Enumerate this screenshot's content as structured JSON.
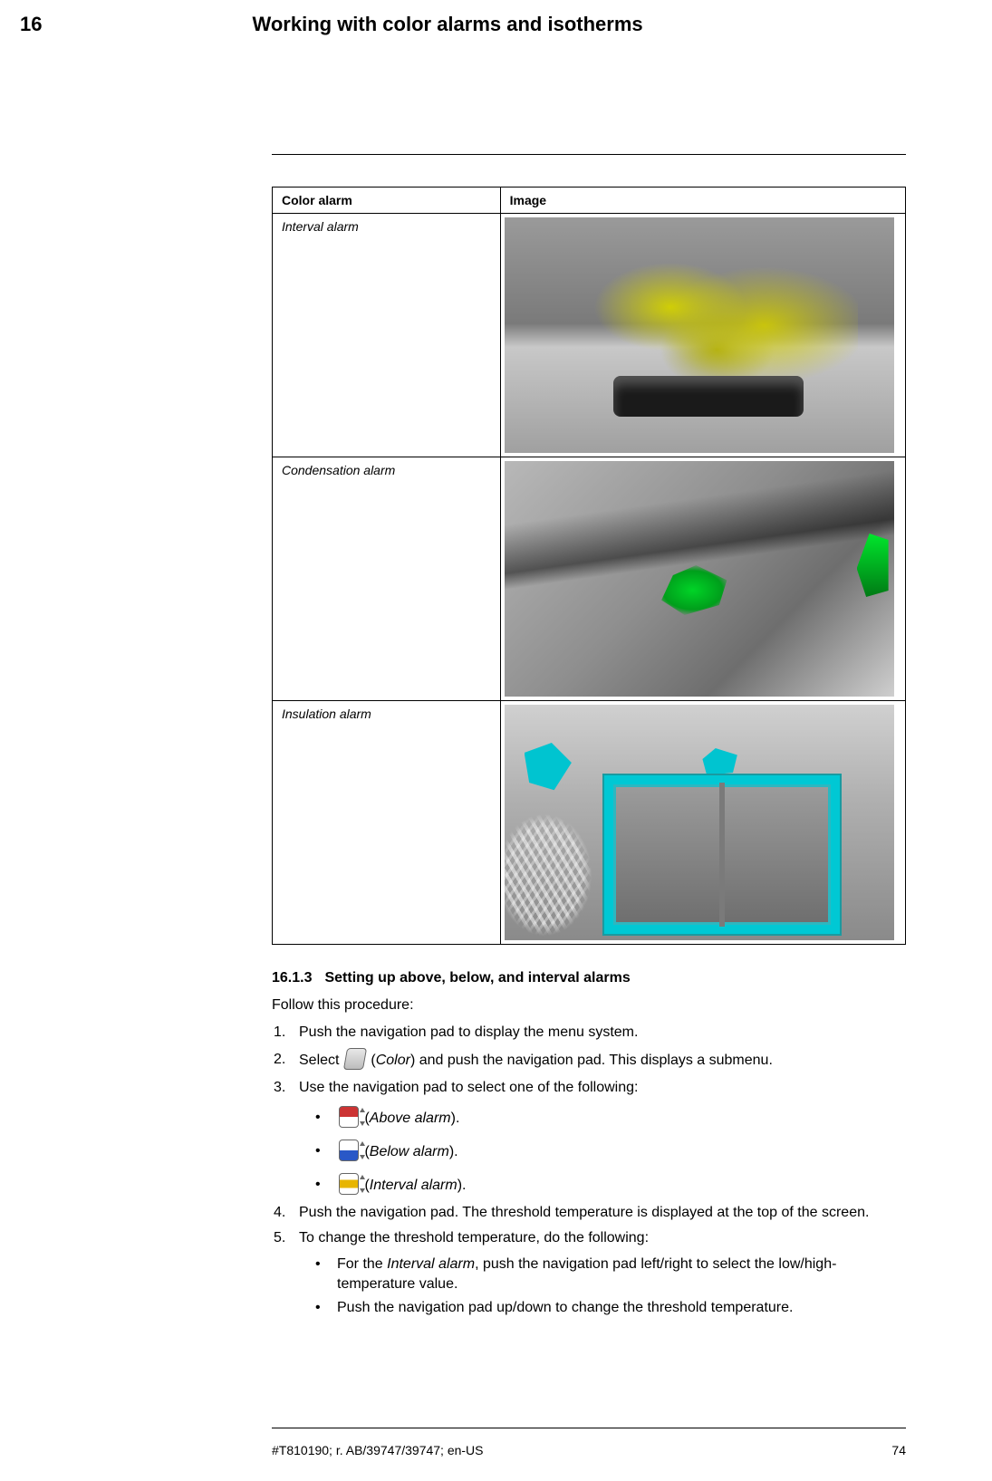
{
  "header": {
    "chapter_number": "16",
    "chapter_title": "Working with color alarms and isotherms"
  },
  "table": {
    "col1_header": "Color alarm",
    "col2_header": "Image",
    "rows": [
      {
        "label": "Interval alarm"
      },
      {
        "label": "Condensation alarm"
      },
      {
        "label": "Insulation alarm"
      }
    ]
  },
  "section": {
    "number": "16.1.3",
    "title": "Setting up above, below, and interval alarms",
    "lead": "Follow this procedure:"
  },
  "steps": {
    "s1": "Push the navigation pad to display the menu system.",
    "s2_pre": "Select ",
    "s2_paren_open": "(",
    "s2_color_italic": "Color",
    "s2_post": ") and push the navigation pad. This displays a submenu.",
    "s3": "Use the navigation pad to select one of the following:",
    "opts": {
      "above_open": "(",
      "above_it": "Above alarm",
      "above_close": ").",
      "below_open": "(",
      "below_it": "Below alarm",
      "below_close": ").",
      "interval_open": "(",
      "interval_it": "Interval alarm",
      "interval_close": ")."
    },
    "s4": "Push the navigation pad. The threshold temperature is displayed at the top of the screen.",
    "s5": "To change the threshold temperature, do the following:",
    "s5a_pre": "For the ",
    "s5a_it": "Interval alarm",
    "s5a_post": ", push the navigation pad left/right to select the low/high-temperature value.",
    "s5b": "Push the navigation pad up/down to change the threshold temperature."
  },
  "footer": {
    "doc_id": "#T810190; r. AB/39747/39747; en-US",
    "page_number": "74"
  }
}
